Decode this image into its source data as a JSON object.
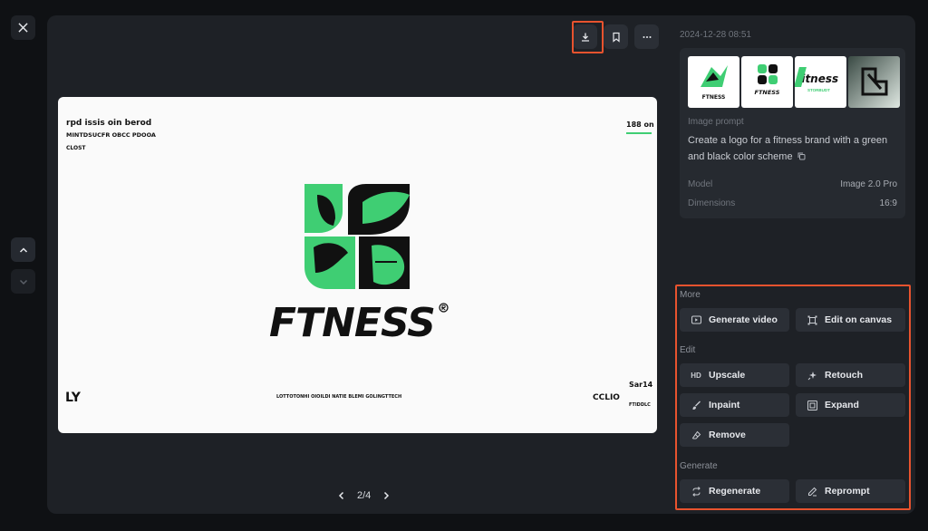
{
  "nav": {
    "close_icon": "close-icon",
    "prev_icon": "chevron-up-icon",
    "next_icon": "chevron-down-icon"
  },
  "toolbar": {
    "download_icon": "download-icon",
    "bookmark_icon": "bookmark-icon",
    "more_icon": "more-horizontal-icon"
  },
  "image": {
    "brand_text": "FTNESS",
    "top_left_line1": "rpd issis oin berod",
    "top_left_line2": "MINTDSUCFR OBCC PDOOA",
    "top_left_line3": "CLOST",
    "top_right": "188 on",
    "bottom_center": "LOTTOTONHI OIOILDI NATIE BLEMI GOLINGTTECH",
    "bottom_right_line1": "Sar14",
    "bottom_right_line2": "CCLIO",
    "bottom_right_line3": "FTIDDLC",
    "bottom_left": "LY"
  },
  "pager": {
    "current": "2/4"
  },
  "details": {
    "timestamp": "2024-12-28 08:51",
    "prompt_label": "Image prompt",
    "prompt_text": "Create a logo for a fitness brand with a green and black color scheme",
    "model_label": "Model",
    "model_value": "Image 2.0 Pro",
    "dimensions_label": "Dimensions",
    "dimensions_value": "16:9",
    "thumbs": [
      {
        "caption": "FTNESS"
      },
      {
        "caption": "FTNESS"
      },
      {
        "caption": "fitness",
        "sub": "STORBUDT"
      },
      {
        "caption": ""
      }
    ]
  },
  "actions": {
    "more_label": "More",
    "generate_video": "Generate video",
    "edit_on_canvas": "Edit on canvas",
    "edit_label": "Edit",
    "upscale_prefix": "HD",
    "upscale": "Upscale",
    "retouch": "Retouch",
    "inpaint": "Inpaint",
    "expand": "Expand",
    "remove": "Remove",
    "generate_label": "Generate",
    "regenerate": "Regenerate",
    "reprompt": "Reprompt"
  },
  "colors": {
    "accent_green": "#3fce73",
    "highlight_red": "#e8532e"
  }
}
